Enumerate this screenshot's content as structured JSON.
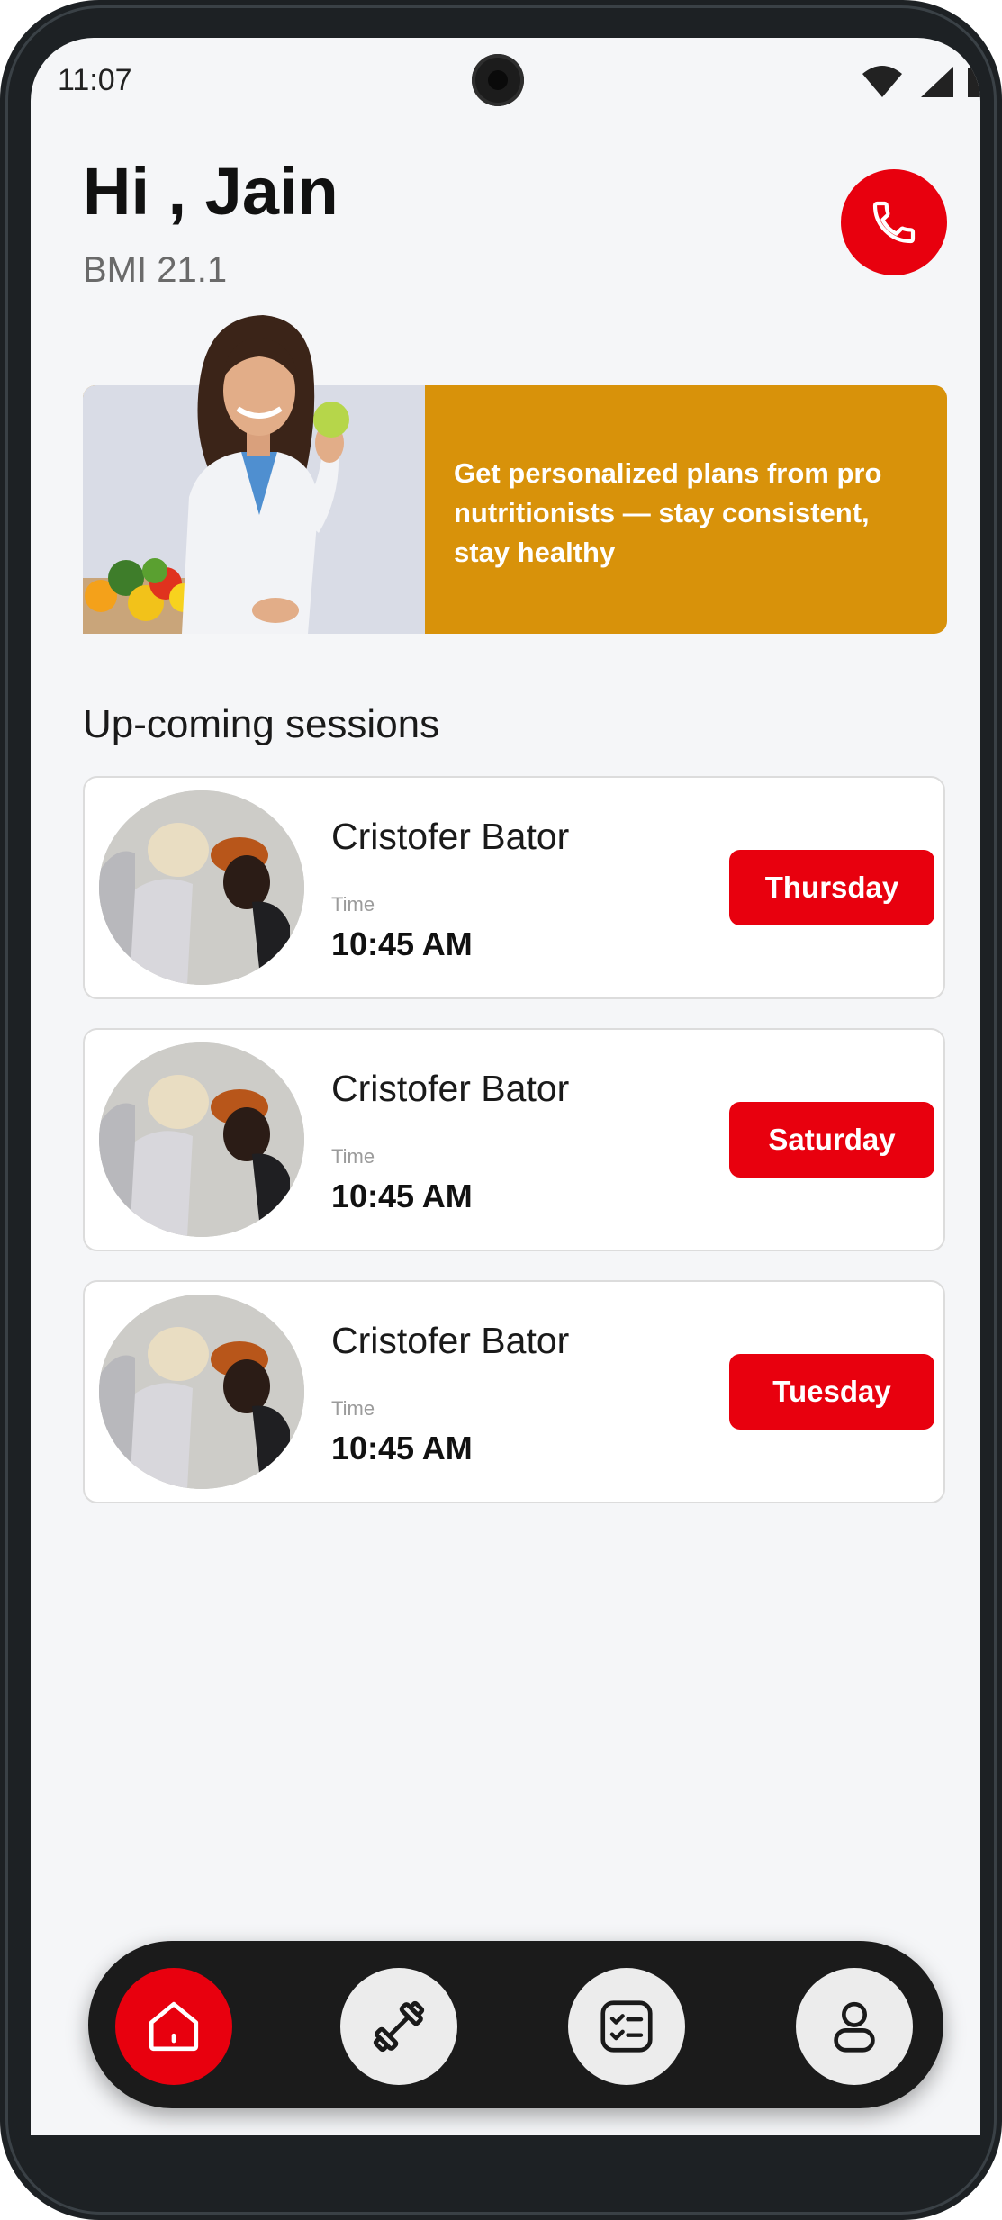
{
  "status_bar": {
    "time": "11:07"
  },
  "header": {
    "greeting": "Hi , Jain",
    "bmi": "BMI 21.1"
  },
  "banner": {
    "text": "Get personalized plans from pro nutritionists — stay consistent, stay healthy"
  },
  "sessions": {
    "title": "Up-coming sessions",
    "items": [
      {
        "name": "Cristofer Bator",
        "time_label": "Time",
        "time": "10:45 AM",
        "day": "Thursday"
      },
      {
        "name": "Cristofer Bator",
        "time_label": "Time",
        "time": "10:45 AM",
        "day": "Saturday"
      },
      {
        "name": "Cristofer Bator",
        "time_label": "Time",
        "time": "10:45 AM",
        "day": "Tuesday"
      }
    ]
  },
  "nav": {
    "items": [
      {
        "icon": "home-icon",
        "active": true
      },
      {
        "icon": "dumbbell-icon",
        "active": false
      },
      {
        "icon": "checklist-icon",
        "active": false
      },
      {
        "icon": "profile-icon",
        "active": false
      }
    ]
  },
  "colors": {
    "accent": "#e8000e",
    "banner": "#d8920a",
    "nav_bg": "#1b1b1b",
    "screen_bg": "#f5f6f8"
  }
}
